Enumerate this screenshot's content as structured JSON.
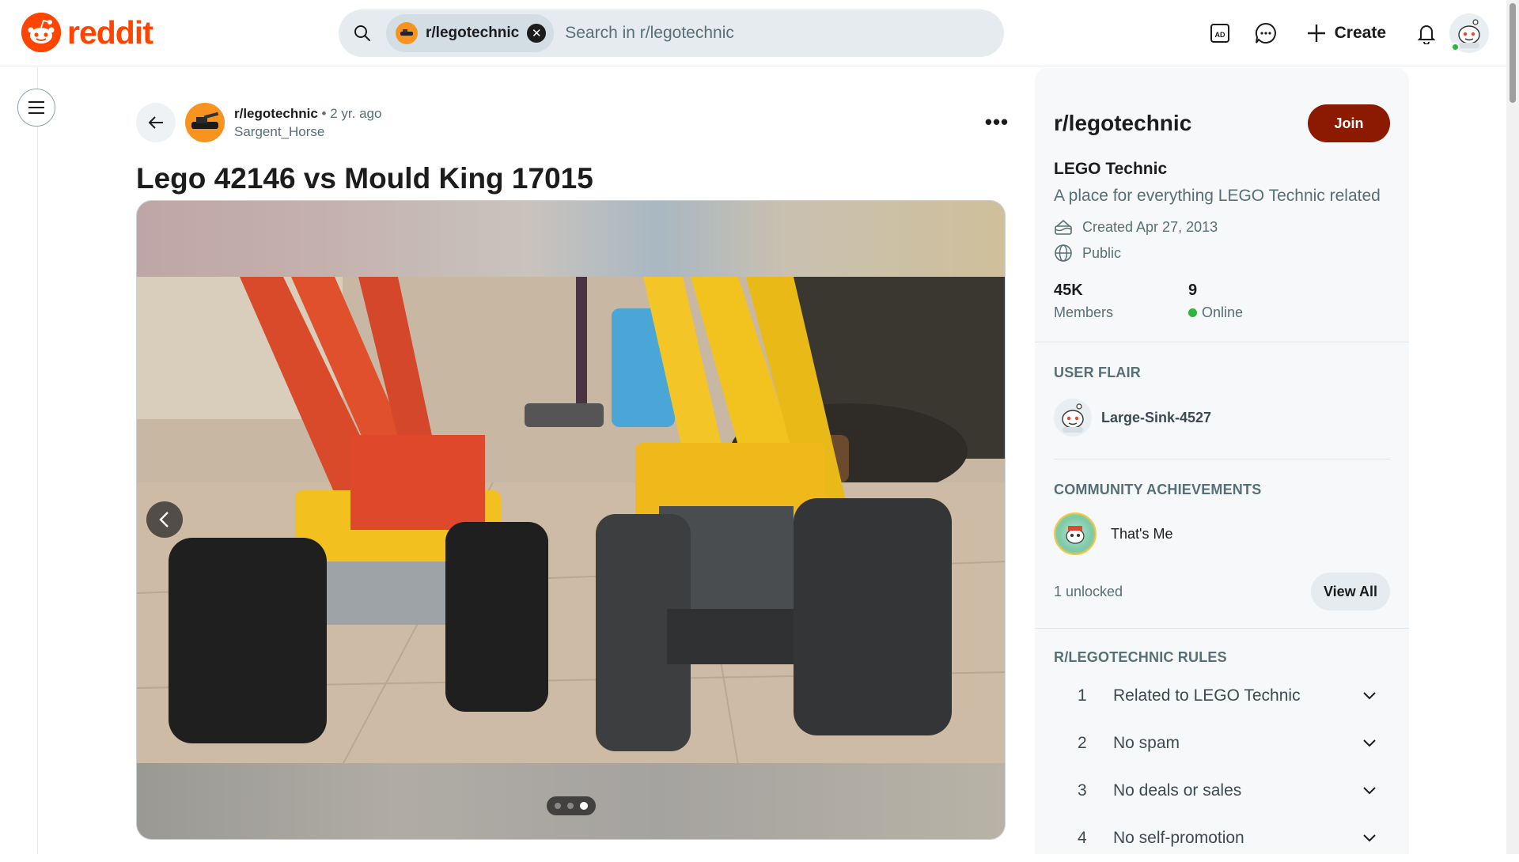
{
  "brand": {
    "name": "reddit",
    "accent_color": "#ff4500"
  },
  "header": {
    "search": {
      "community_chip": "r/legotechnic",
      "placeholder": "Search in r/legotechnic"
    },
    "create_label": "Create",
    "icons": [
      "advertise-icon",
      "chat-icon",
      "plus-icon",
      "bell-icon",
      "profile-avatar"
    ]
  },
  "post": {
    "subreddit": "r/legotechnic",
    "separator": "•",
    "time": "2 yr. ago",
    "author": "Sargent_Horse",
    "more_label": "•••",
    "title": "Lego 42146 vs Mould King 17015",
    "gallery": {
      "total_images": 3,
      "current_index": 3
    }
  },
  "sidebar": {
    "community_name": "r/legotechnic",
    "join_label": "Join",
    "join_color": "#8b1a00",
    "title": "LEGO Technic",
    "description": "A place for everything LEGO Technic related",
    "created": "Created Apr 27, 2013",
    "visibility": "Public",
    "stats": {
      "members_count": "45K",
      "members_label": "Members",
      "online_count": "9",
      "online_label": "Online"
    },
    "user_flair_label": "USER FLAIR",
    "user_flair_name": "Large-Sink-4527",
    "achievements_label": "COMMUNITY ACHIEVEMENTS",
    "achievement_name": "That's Me",
    "unlocked": "1 unlocked",
    "view_all_label": "View All",
    "rules_label": "R/LEGOTECHNIC RULES",
    "rules": [
      {
        "num": "1",
        "text": "Related to LEGO Technic"
      },
      {
        "num": "2",
        "text": "No spam"
      },
      {
        "num": "3",
        "text": "No deals or sales"
      },
      {
        "num": "4",
        "text": "No self-promotion"
      }
    ]
  }
}
